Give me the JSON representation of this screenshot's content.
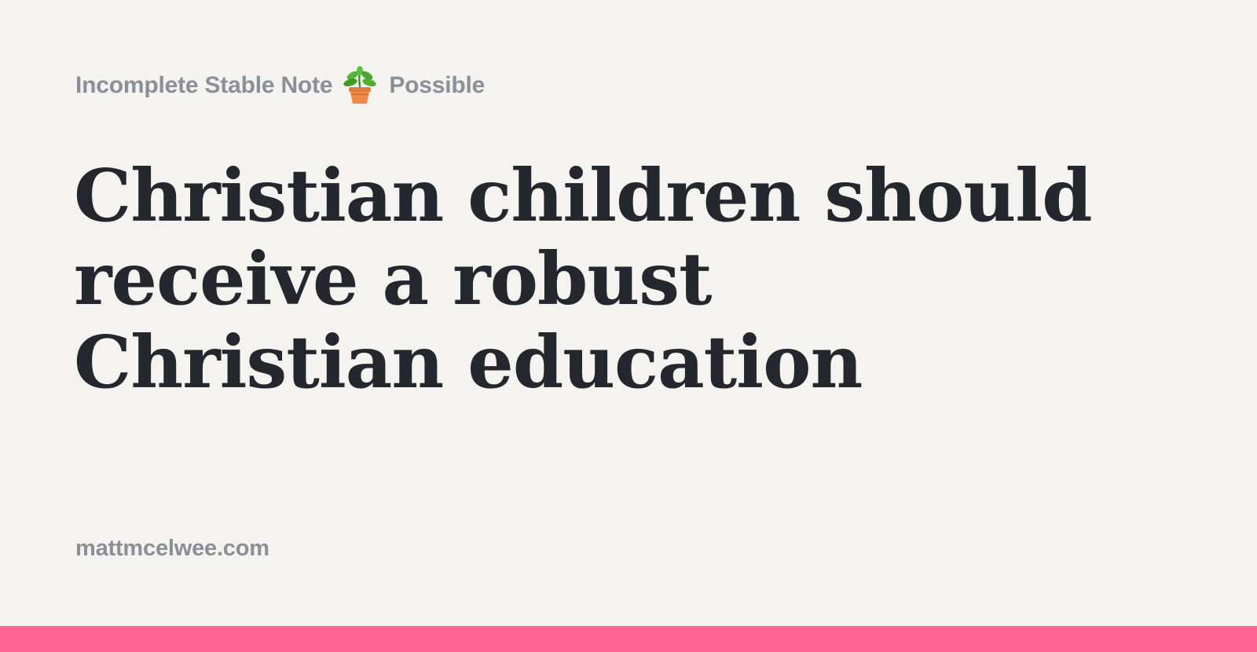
{
  "header": {
    "note_status": "Incomplete Stable Note",
    "status_icon": "potted-plant-icon",
    "confidence": "Possible"
  },
  "title": "Christian children should receive a robust Christian education",
  "footer": {
    "site": "mattmcelwee.com"
  },
  "colors": {
    "background": "#f4f3ef",
    "title_text": "#24272d",
    "muted_text": "#8a8f98",
    "accent_bar": "#ff6594"
  }
}
